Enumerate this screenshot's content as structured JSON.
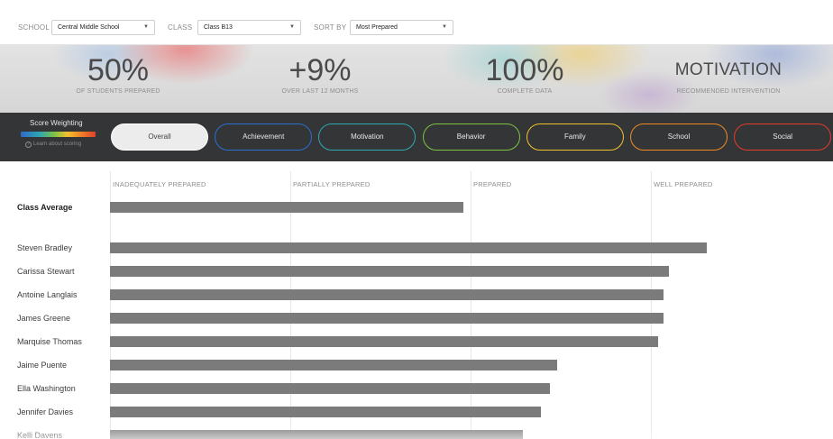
{
  "filters": {
    "school_label": "SCHOOL",
    "school_value": "Central Middle School",
    "class_label": "CLASS",
    "class_value": "Class B13",
    "sort_label": "SORT BY",
    "sort_value": "Most Prepared",
    "caret": "▼"
  },
  "stats": [
    {
      "value": "50%",
      "label": "OF STUDENTS PREPARED"
    },
    {
      "value": "+9%",
      "label": "OVER LAST 12 MONTHS"
    },
    {
      "value": "100%",
      "label": "COMPLETE DATA"
    },
    {
      "value": "MOTIVATION",
      "label": "RECOMMENDED INTERVENTION"
    }
  ],
  "weighting": {
    "title": "Score Weighting",
    "link": "Learn about scoring",
    "link_icon": "?"
  },
  "tabs": [
    {
      "label": "Overall",
      "color": "#ffffff",
      "active": true
    },
    {
      "label": "Achievement",
      "color": "#2c6fd0",
      "active": false
    },
    {
      "label": "Motivation",
      "color": "#2ea9b0",
      "active": false
    },
    {
      "label": "Behavior",
      "color": "#7ec242",
      "active": false
    },
    {
      "label": "Family",
      "color": "#f2c12e",
      "active": false
    },
    {
      "label": "School",
      "color": "#f08a24",
      "active": false
    },
    {
      "label": "Social",
      "color": "#e23c2b",
      "active": false
    }
  ],
  "chart_data": {
    "type": "bar",
    "orientation": "horizontal",
    "bands": [
      "INADEQUATELY PREPARED",
      "PARTIALLY PREPARED",
      "PREPARED",
      "WELL PREPARED"
    ],
    "xlim": [
      0,
      4
    ],
    "class_average": {
      "label": "Class Average",
      "value": 1.96
    },
    "students": [
      {
        "name": "Steven Bradley",
        "value": 3.31
      },
      {
        "name": "Carissa Stewart",
        "value": 3.1
      },
      {
        "name": "Antoine Langlais",
        "value": 3.07
      },
      {
        "name": "James Greene",
        "value": 3.07
      },
      {
        "name": "Marquise Thomas",
        "value": 3.04
      },
      {
        "name": "Jaime Puente",
        "value": 2.48
      },
      {
        "name": "Ella Washington",
        "value": 2.44
      },
      {
        "name": "Jennifer Davies",
        "value": 2.39
      },
      {
        "name": "Kelli Davens",
        "value": 2.29
      }
    ],
    "bar_color": "#7b7b7b"
  }
}
